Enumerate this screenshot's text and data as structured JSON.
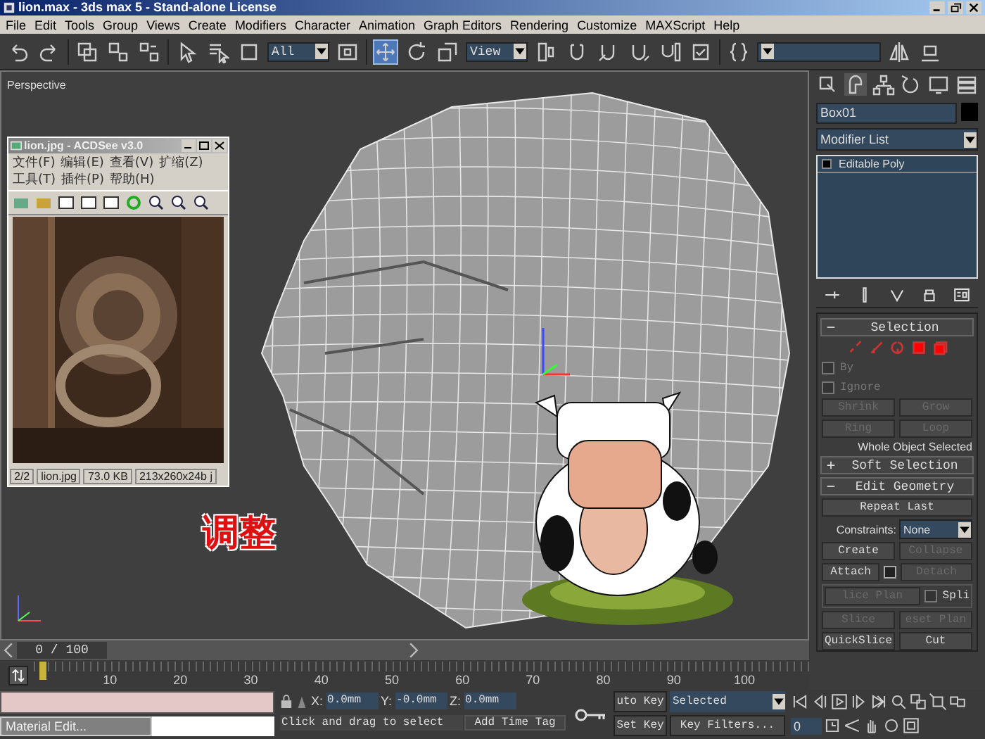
{
  "window": {
    "title": "lion.max - 3ds max 5 - Stand-alone License"
  },
  "menu": [
    "File",
    "Edit",
    "Tools",
    "Group",
    "Views",
    "Create",
    "Modifiers",
    "Character",
    "Animation",
    "Graph Editors",
    "Rendering",
    "Customize",
    "MAXScript",
    "Help"
  ],
  "toolbar": {
    "selection_filter": "All",
    "reference_coord": "View",
    "transform_tools": [
      {
        "selected": true
      },
      {
        "selected": false
      },
      {
        "selected": false
      }
    ]
  },
  "viewport": {
    "label": "Perspective",
    "caption": "调整"
  },
  "image_viewer": {
    "title": "lion.jpg - ACDSee v3.0",
    "menu": [
      "文件(F)",
      "编辑(E)",
      "查看(V)",
      "扩缩(Z)",
      "工具(T)",
      "插件(P)",
      "帮助(H)"
    ],
    "status": [
      "2/2",
      "lion.jpg",
      "73.0 KB",
      "213x260x24b j"
    ]
  },
  "command_panel": {
    "object_name": "Box01",
    "modifier_list": "Modifier List",
    "stack": [
      {
        "label": "Editable Poly",
        "selected": false
      }
    ],
    "rollouts": [
      {
        "title": "Selection",
        "expanded": true,
        "rows": [
          {
            "kind": "subobject"
          },
          {
            "kind": "checkbox",
            "label": "By",
            "checked": false,
            "disabled": true
          },
          {
            "kind": "checkbox",
            "label": "Ignore",
            "checked": false,
            "disabled": true
          },
          {
            "kind": "buttons",
            "buttons": [
              {
                "label": "Shrink",
                "disabled": true
              },
              {
                "label": "Grow",
                "disabled": true
              }
            ]
          },
          {
            "kind": "buttons",
            "buttons": [
              {
                "label": "Ring",
                "disabled": true
              },
              {
                "label": "Loop",
                "disabled": true
              }
            ]
          },
          {
            "kind": "note",
            "label": "Whole Object Selected"
          }
        ]
      },
      {
        "title": "Soft Selection",
        "expanded": false
      },
      {
        "title": "Edit Geometry",
        "expanded": true,
        "rows": [
          {
            "kind": "buttons",
            "buttons": [
              {
                "label": "Repeat Last",
                "disabled": false
              }
            ]
          },
          {
            "kind": "dropdown",
            "label": "Constraints:",
            "value": "None"
          },
          {
            "kind": "buttons",
            "buttons": [
              {
                "label": "Create",
                "disabled": false
              },
              {
                "label": "Collapse",
                "disabled": true
              }
            ]
          },
          {
            "kind": "attach",
            "buttons": [
              {
                "label": "Attach",
                "disabled": false
              },
              {
                "label": "Detach",
                "disabled": true
              }
            ]
          },
          {
            "kind": "split",
            "buttons": [
              {
                "label": "lice Plan",
                "disabled": true
              }
            ],
            "checkbox": {
              "label": "Spli",
              "checked": false
            }
          },
          {
            "kind": "buttons",
            "buttons": [
              {
                "label": "Slice",
                "disabled": true
              },
              {
                "label": "eset Plan",
                "disabled": true
              }
            ]
          },
          {
            "kind": "buttons",
            "buttons": [
              {
                "label": "QuickSlice",
                "disabled": false
              },
              {
                "label": "Cut",
                "disabled": false
              }
            ]
          }
        ]
      }
    ]
  },
  "timeline": {
    "position": "0 / 100",
    "level": 0,
    "ticks": [
      "10",
      "20",
      "30",
      "40",
      "50",
      "60",
      "70",
      "80",
      "90",
      "100"
    ]
  },
  "status_bar": {
    "taskbar": [
      {
        "title": "Material Edit..."
      }
    ],
    "x_label": "X:",
    "x": "0.0mm",
    "y_label": "Y:",
    "y": "-0.0mm",
    "z_label": "Z:",
    "z": "0.0mm",
    "prompt": "Click and drag to select",
    "time_tag": "Add Time Tag",
    "auto_key": "uto Key",
    "set_key": "Set Key",
    "key_mode": "Selected",
    "key_filters": "Key Filters...",
    "frame": "0"
  }
}
